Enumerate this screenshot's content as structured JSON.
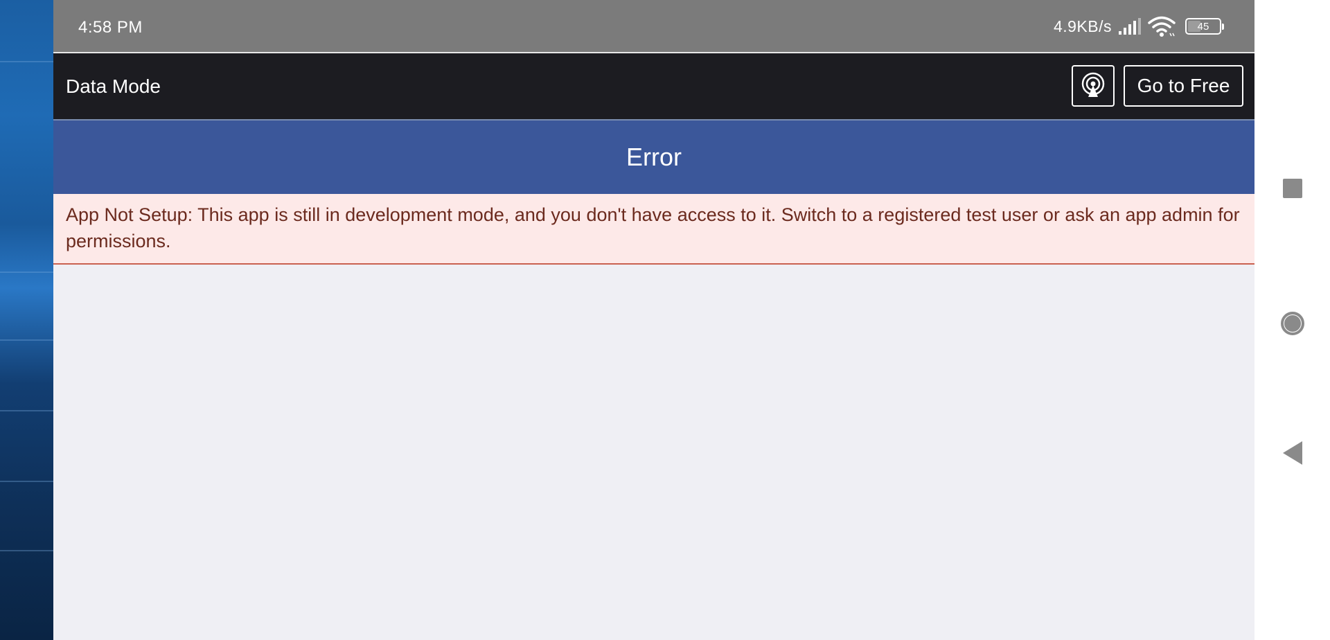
{
  "status_bar": {
    "time": "4:58 PM",
    "network_speed": "4.9KB/s",
    "signal_icon": "signal-bars-icon",
    "wifi_icon": "wifi-icon",
    "battery_level": "45",
    "battery_percent": 45
  },
  "header": {
    "title": "Data Mode",
    "broadcast_icon": "broadcast-icon",
    "go_free_label": "Go to Free",
    "background_color": "#1c1c21"
  },
  "error": {
    "title": "Error",
    "message": "App Not Setup: This app is still in development mode, and you don't have access to it. Switch to a registered test user or ask an app admin for permissions.",
    "title_bar_color": "#3b579a",
    "message_background": "#fde9e8",
    "message_text_color": "#6b2a1e"
  },
  "system_nav": {
    "recents_icon": "recents-square-icon",
    "home_icon": "home-circle-icon",
    "back_icon": "back-triangle-icon"
  }
}
